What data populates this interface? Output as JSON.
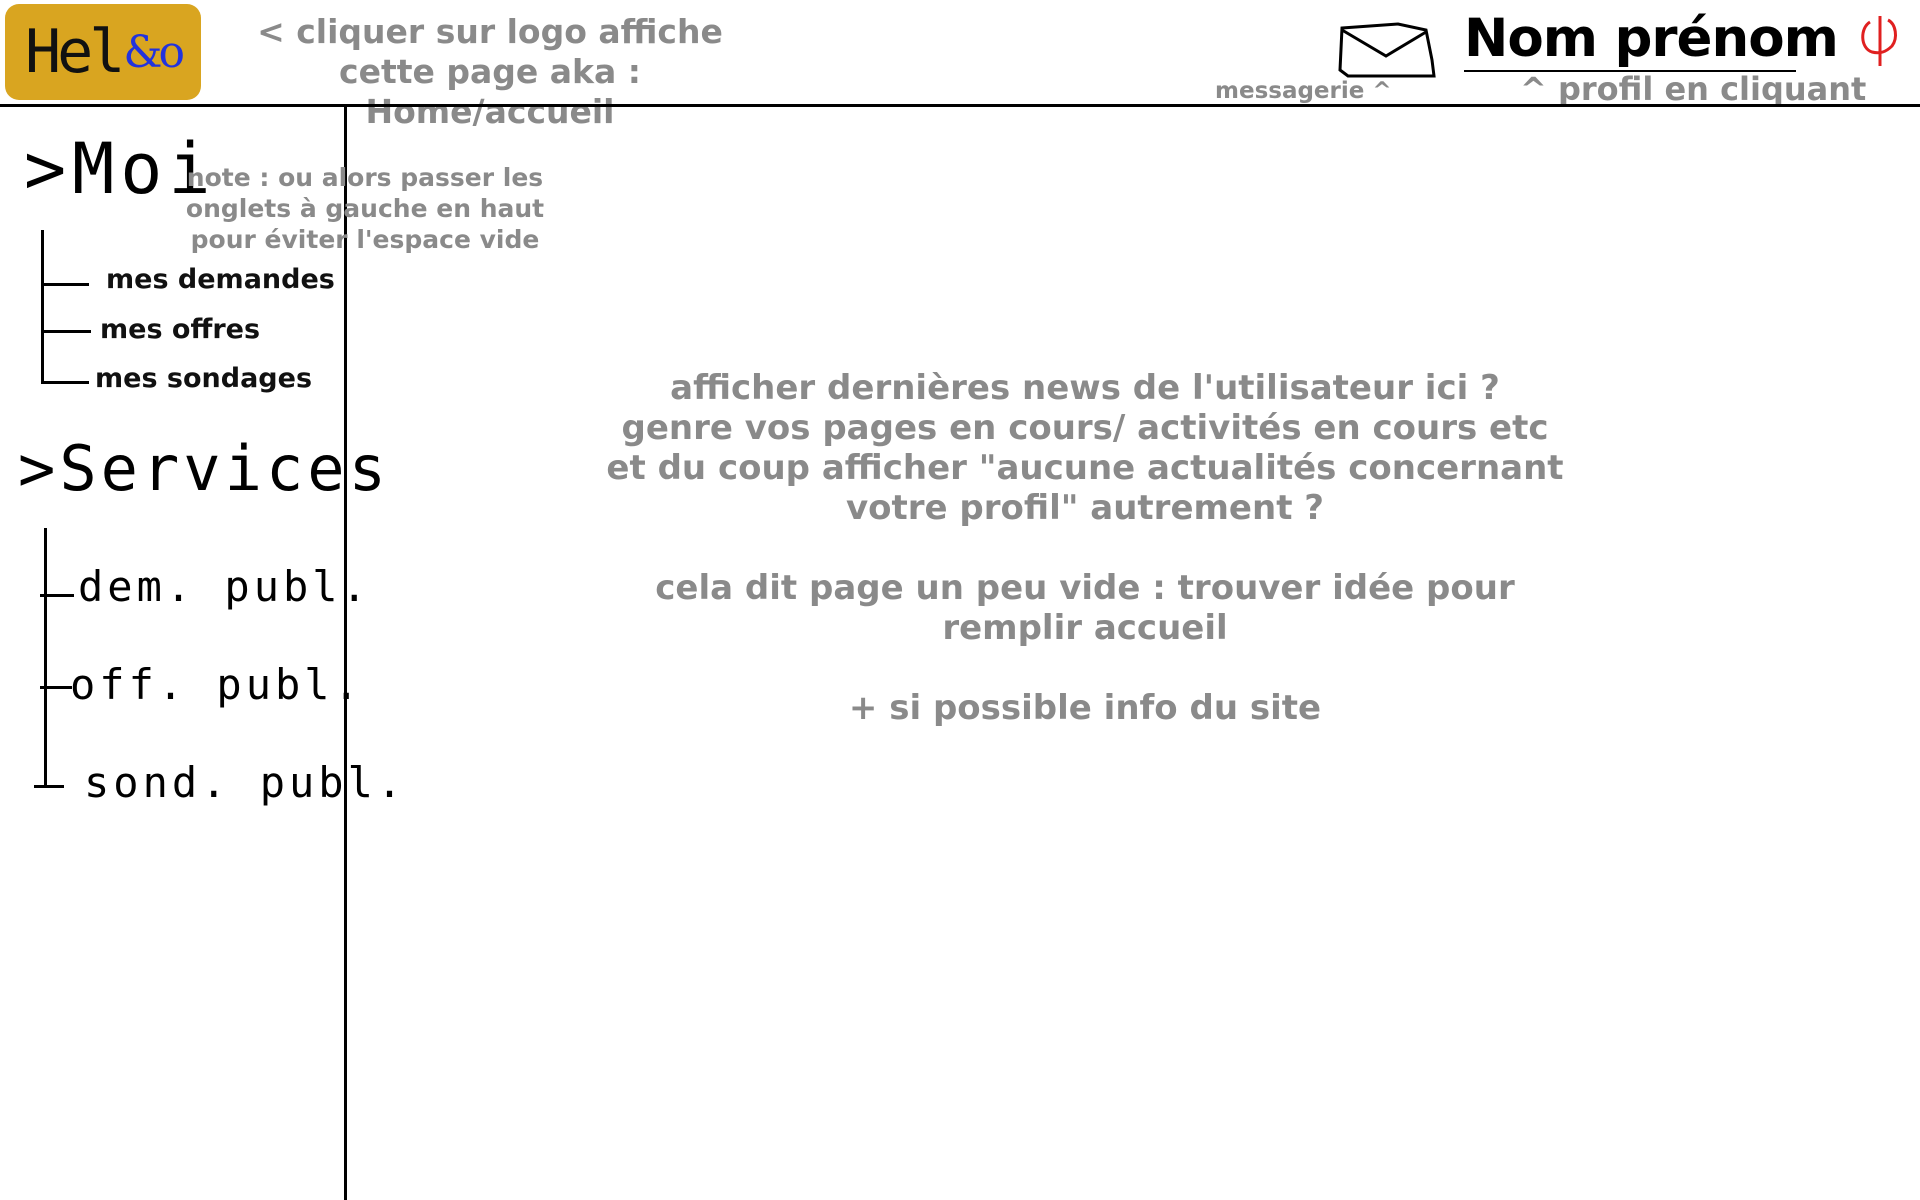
{
  "header": {
    "logo": {
      "text": "Hel",
      "symbol": "&o",
      "background": "#d9a520",
      "symbol_color": "#2233dd"
    },
    "logo_note": "< cliquer sur logo affiche cette page aka : Home/accueil",
    "messaging": {
      "icon": "envelope-icon",
      "label": "messagerie ^"
    },
    "profile": {
      "name": "Nom prénom",
      "note": "^ profil en cliquant"
    },
    "logout": {
      "icon": "power-icon",
      "color": "#e02020"
    }
  },
  "sidebar": {
    "moi": {
      "label": ">Moi",
      "items": [
        "mes demandes",
        "mes offres",
        "mes sondages"
      ]
    },
    "services": {
      "label": ">Services",
      "items": [
        "dem. publ.",
        "off. publ.",
        "sond. publ."
      ]
    },
    "note": "note : ou alors passer les onglets à gauche en haut pour éviter l'espace vide"
  },
  "main": {
    "lines": [
      "afficher dernières news de l'utilisateur ici ?",
      "genre vos pages en cours/ activités en cours etc",
      "et du coup afficher \"aucune actualités concernant votre profil\" autrement ?",
      "cela dit page un peu vide : trouver idée pour remplir accueil",
      "+ si possible info du site"
    ]
  },
  "colors": {
    "note_text": "#8a8a8a",
    "line": "#000000",
    "background": "#ffffff"
  }
}
